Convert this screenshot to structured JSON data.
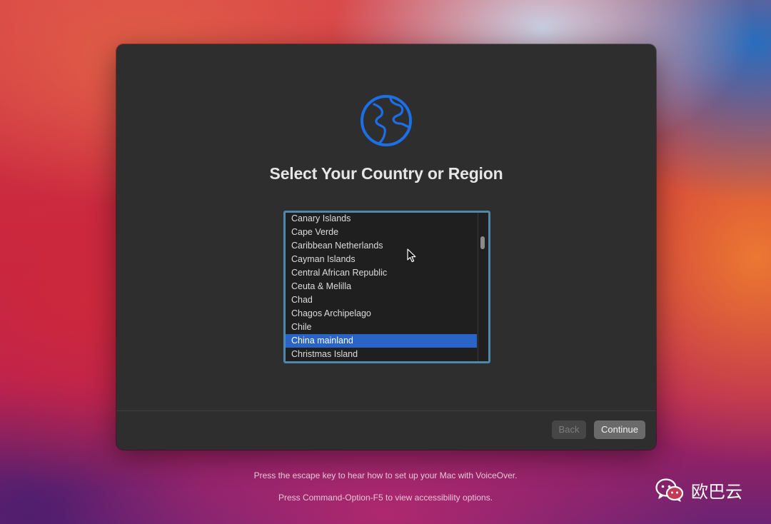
{
  "setup": {
    "title": "Select Your Country or Region",
    "countries": [
      "Canary Islands",
      "Cape Verde",
      "Caribbean Netherlands",
      "Cayman Islands",
      "Central African Republic",
      "Ceuta & Melilla",
      "Chad",
      "Chagos Archipelago",
      "Chile",
      "China mainland",
      "Christmas Island"
    ],
    "selected_country": "China mainland",
    "back_label": "Back",
    "continue_label": "Continue"
  },
  "hints": {
    "voiceover": "Press the escape key to hear how to set up your Mac with VoiceOver.",
    "accessibility": "Press Command-Option-F5 to view accessibility options."
  },
  "watermark": {
    "text": "欧巴云",
    "icon": "wechat-icon"
  },
  "colors": {
    "accent": "#2a64c6",
    "globe": "#1c6fe6",
    "window": "#2e2e2e",
    "list_focus_ring": "#4f88a8"
  },
  "icons": {
    "globe": "globe-icon",
    "cursor": "pointer-cursor-icon"
  }
}
